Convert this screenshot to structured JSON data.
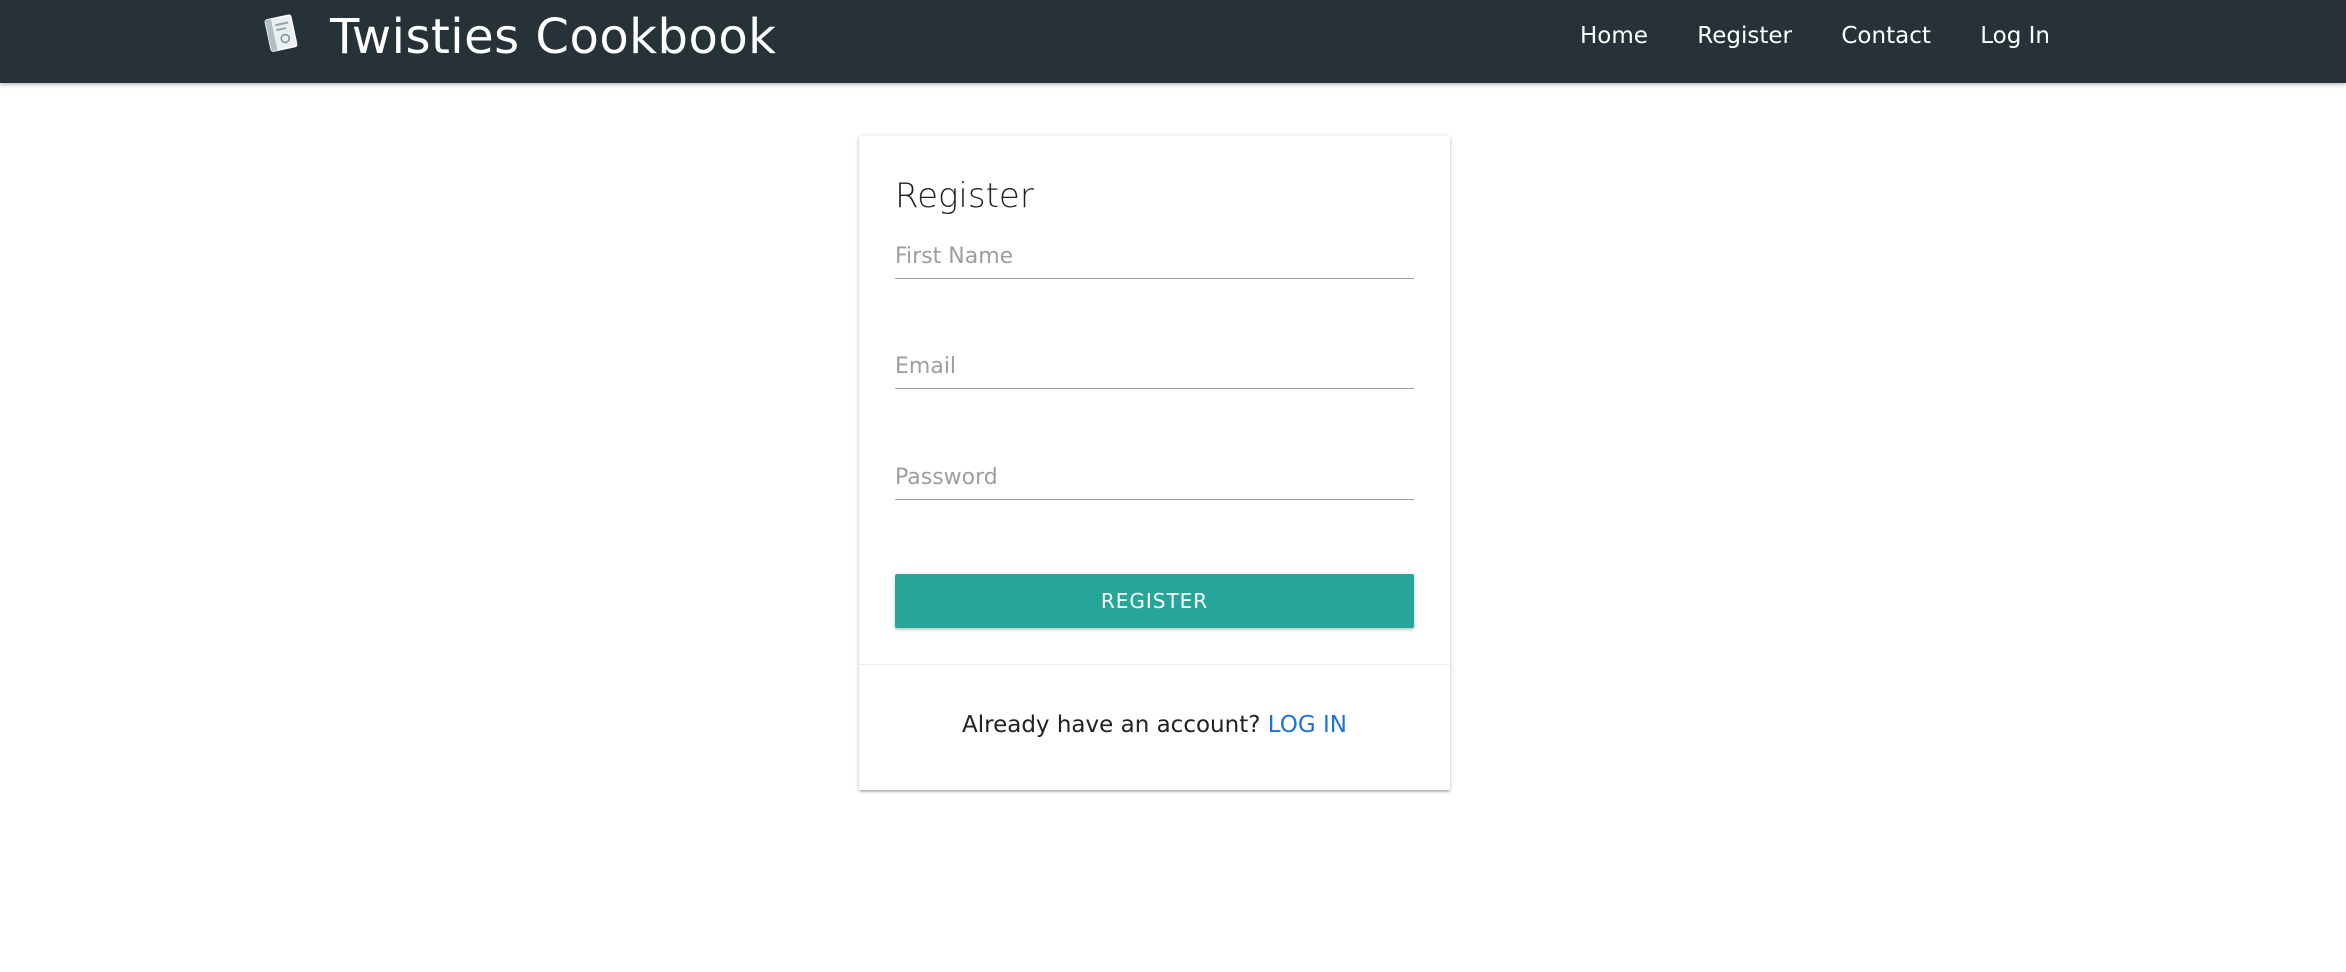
{
  "header": {
    "brand_title": "Twisties Cookbook",
    "brand_icon": "cookbook-icon",
    "nav": [
      {
        "label": "Home"
      },
      {
        "label": "Register"
      },
      {
        "label": "Contact"
      },
      {
        "label": "Log In"
      }
    ],
    "background_color": "#263238"
  },
  "form": {
    "title": "Register",
    "fields": {
      "first_name": {
        "placeholder": "First Name",
        "value": ""
      },
      "email": {
        "placeholder": "Email",
        "value": ""
      },
      "password": {
        "placeholder": "Password",
        "value": ""
      }
    },
    "submit_label": "REGISTER",
    "submit_color": "#26a69a",
    "footer_text": "Already have an account?",
    "footer_link": "LOG IN",
    "footer_link_color": "#1e73d8"
  }
}
